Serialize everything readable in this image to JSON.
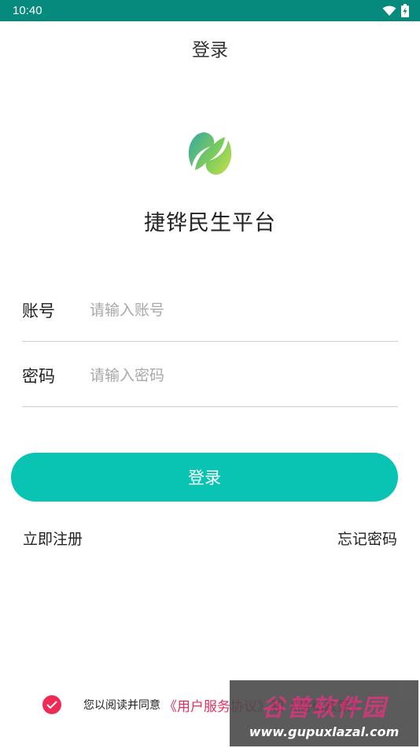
{
  "status_bar": {
    "time": "10:40",
    "battery_level": "",
    "wifi_icon": "wifi-icon",
    "battery_icon": "battery-charging-icon"
  },
  "header": {
    "title": "登录"
  },
  "app": {
    "name": "捷铧民生平台",
    "logo_icon": "leaf-logo-icon"
  },
  "form": {
    "account": {
      "label": "账号",
      "placeholder": "请输入账号",
      "value": ""
    },
    "password": {
      "label": "密码",
      "placeholder": "请输入密码",
      "value": ""
    },
    "submit_label": "登录"
  },
  "links": {
    "register": "立即注册",
    "forgot": "忘记密码"
  },
  "agreement": {
    "checked": true,
    "text": "您以阅读并同意",
    "link": "《用户服务协议》和《隐私政策》"
  },
  "watermark": {
    "logo_text": "谷普软件园",
    "url": "www.gupuxlazal.com"
  },
  "colors": {
    "status_bar": "#068a7d",
    "accent": "#0ac4b3",
    "check": "#ee2b57",
    "link": "#e0315a"
  }
}
